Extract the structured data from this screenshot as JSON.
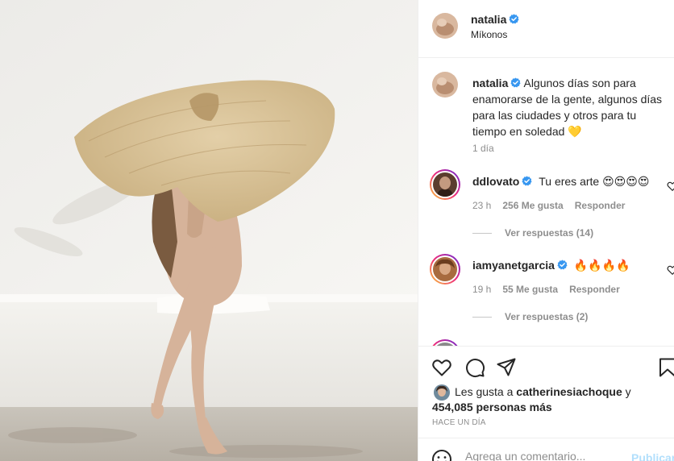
{
  "post": {
    "author": "natalia",
    "location": "Míkonos",
    "caption": "Algunos días son para enamorarse de la gente, algunos días para las ciudades y otros para tu tiempo en soledad 💛",
    "caption_time": "1 día"
  },
  "comments": [
    {
      "username": "ddlovato",
      "text": "Tu eres arte 😍😍😍😍",
      "time": "23 h",
      "likes": "256 Me gusta",
      "reply_label": "Responder",
      "view_replies": "Ver respuestas (14)"
    },
    {
      "username": "iamyanetgarcia",
      "text": "🔥🔥🔥🔥",
      "time": "19 h",
      "likes": "55 Me gusta",
      "reply_label": "Responder",
      "view_replies": "Ver respuestas (2)"
    }
  ],
  "likes": {
    "prefix": "Les gusta a",
    "user": "catherinesiachoque",
    "joiner": "y",
    "others": "454,085 personas más"
  },
  "time_ago": "HACE UN DÍA",
  "composer": {
    "placeholder": "Agrega un comentario...",
    "post_label": "Publicar"
  },
  "icons": {
    "like": "heart-icon",
    "comment": "comment-icon",
    "share": "send-icon",
    "save": "bookmark-icon",
    "emoji": "emoji-icon",
    "verified": "verified-badge-icon"
  },
  "colors": {
    "verified": "#3897f0",
    "muted": "#8e8e8e",
    "post_button_disabled": "#b2dffc"
  }
}
